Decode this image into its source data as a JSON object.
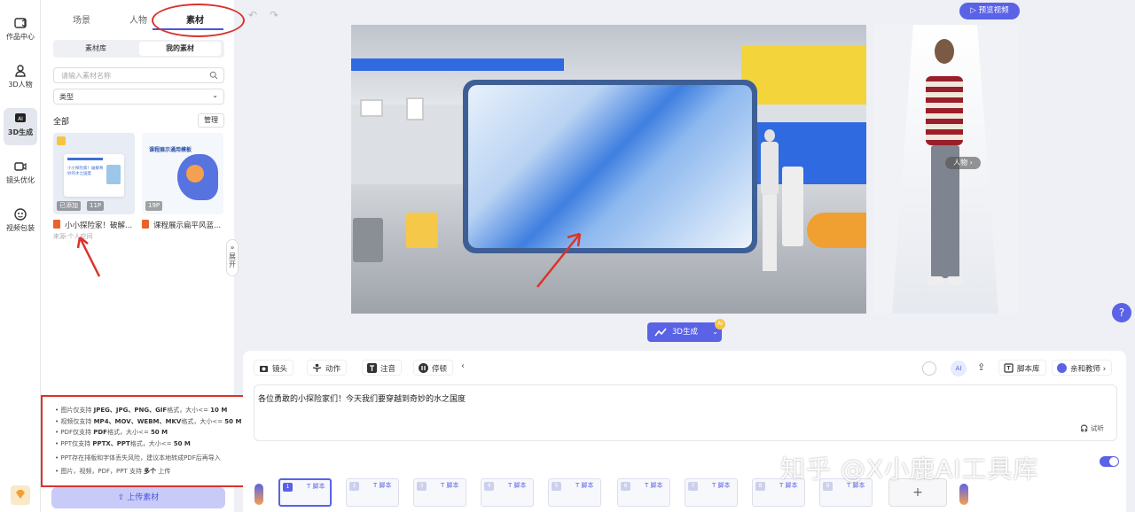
{
  "nav": [
    {
      "label": "作品中心",
      "icon": "folder-icon"
    },
    {
      "label": "3D人物",
      "icon": "person-icon"
    },
    {
      "label": "3D生成",
      "icon": "ai-icon"
    },
    {
      "label": "镜头优化",
      "icon": "camera-icon"
    },
    {
      "label": "视频包装",
      "icon": "package-icon"
    }
  ],
  "panel": {
    "tabs": [
      "场景",
      "人物",
      "素材"
    ],
    "segments": [
      "素材库",
      "我的素材"
    ],
    "search_placeholder": "请输入素材名称",
    "filter_label": "类型",
    "section_title": "全部",
    "manage_label": "管理",
    "cards": [
      {
        "title": "小小探险家！破解...",
        "source": "来源-个人空间",
        "badges": [
          "已添加",
          "11P"
        ],
        "thumb_text": "小小探险家！破解奇妙的水之国度"
      },
      {
        "title": "课程展示扁平风蓝...",
        "source": "",
        "badges": [
          "19P"
        ],
        "thumb_text": "课程展示通用模板"
      }
    ],
    "expand_label": "展开",
    "upload_label": "上传素材"
  },
  "tips": [
    {
      "pre": "图片仅支持 ",
      "bold": "JPEG、JPG、PNG、GIF",
      "post": "格式，大小<= ",
      "bold2": "10 M"
    },
    {
      "pre": "视频仅支持 ",
      "bold": "MP4、MOV、WEBM、MKV",
      "post": "格式，大小<= ",
      "bold2": "50 M"
    },
    {
      "pre": "PDF仅支持 ",
      "bold": "PDF",
      "post": "格式，大小<= ",
      "bold2": "50 M"
    },
    {
      "pre": "PPT仅支持 ",
      "bold": "PPTX、PPT",
      "post": "格式，大小<= ",
      "bold2": "50 M"
    },
    {
      "pre": "PPT存在排版和字体丢失风险，建议本地转成PDF后再导入",
      "bold": "",
      "post": "",
      "bold2": ""
    },
    {
      "pre": "图片，视频，PDF，PPT 支持 ",
      "bold": "多个",
      "post": "上传",
      "bold2": ""
    }
  ],
  "header": {
    "preview_label": "预览视频"
  },
  "avatar": {
    "person_label": "人物"
  },
  "gen3d": {
    "label": "3D生成",
    "badge": "AI"
  },
  "toolbar": {
    "left": [
      "镜头",
      "动作",
      "注音",
      "停顿"
    ],
    "right_script": "脚本库",
    "right_voice": "亲和教师"
  },
  "editor": {
    "text": "各位勇敢的小探险家们！今天我们要穿越到奇妙的水之国度",
    "trial_label": "试听"
  },
  "timeline": {
    "labels": [
      "T 脚本",
      "T 脚本",
      "T 脚本",
      "T 脚本",
      "T 脚本",
      "T 脚本",
      "T 脚本",
      "T 脚本",
      "T 脚本"
    ],
    "numbers": [
      "1",
      "2",
      "3",
      "4",
      "5",
      "6",
      "7",
      "8",
      "9"
    ],
    "add_label": "+"
  },
  "watermark": "知乎 @X小鹿AI工具库",
  "colors": {
    "accent": "#5a62e6",
    "annotation": "#d9342b"
  }
}
